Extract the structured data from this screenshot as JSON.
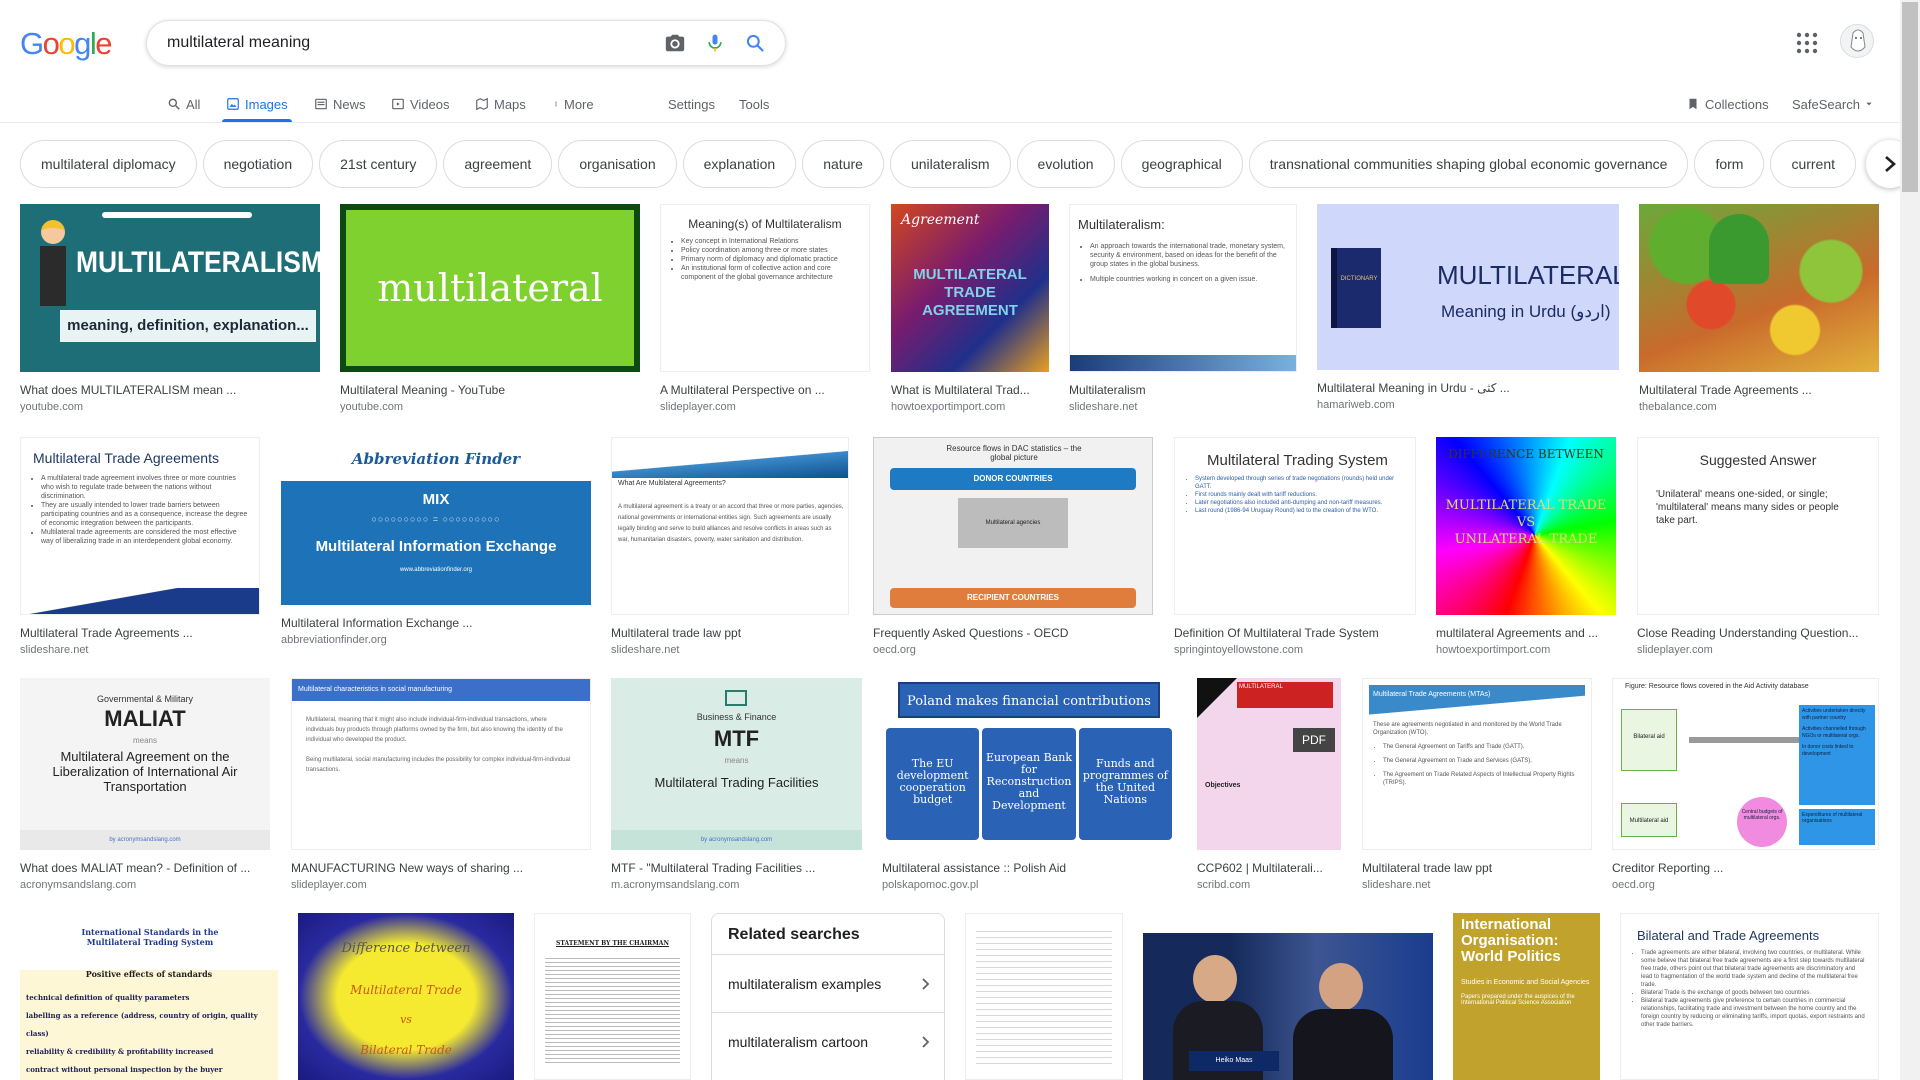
{
  "search": {
    "query": "multilateral meaning"
  },
  "logo": {
    "letters": [
      "G",
      "o",
      "o",
      "g",
      "l",
      "e"
    ],
    "colors": [
      "#4285f4",
      "#ea4335",
      "#fbbc05",
      "#4285f4",
      "#34a853",
      "#ea4335"
    ]
  },
  "tabs": [
    {
      "label": "All",
      "icon": "search-icon"
    },
    {
      "label": "Images",
      "icon": "image-icon"
    },
    {
      "label": "News",
      "icon": "news-icon"
    },
    {
      "label": "Videos",
      "icon": "video-icon"
    },
    {
      "label": "Maps",
      "icon": "map-icon"
    },
    {
      "label": "More",
      "icon": "more-icon"
    }
  ],
  "tools": {
    "settings": "Settings",
    "tools": "Tools",
    "collections": "Collections",
    "safesearch": "SafeSearch"
  },
  "chips": [
    "multilateral diplomacy",
    "negotiation",
    "21st century",
    "agreement",
    "organisation",
    "explanation",
    "nature",
    "unilateralism",
    "evolution",
    "geographical",
    "transnational communities shaping global economic governance",
    "form",
    "current"
  ],
  "results": [
    {
      "caption": "What does MULTILATERALISM mean ...",
      "source": "youtube.com",
      "text": [
        "MULTILATERALISM",
        "meaning, definition, explanation..."
      ]
    },
    {
      "caption": "Multilateral Meaning - YouTube",
      "source": "youtube.com",
      "text": [
        "multilateral"
      ]
    },
    {
      "caption": "A Multilateral Perspective on ...",
      "source": "slideplayer.com",
      "text": [
        "Meaning(s) of Multilateralism",
        "Key concept in International Relations",
        "Policy coordination among three or more states",
        "Primary norm of diplomacy and diplomatic practice",
        "An institutional form of collective action and core component of the global governance architecture"
      ]
    },
    {
      "caption": "What is Multilateral Trad...",
      "source": "howtoexportimport.com",
      "text": [
        "Agreement",
        "MULTILATERAL TRADE AGREEMENT"
      ]
    },
    {
      "caption": "Multilateralism",
      "source": "slideshare.net",
      "text": [
        "Multilateralism:",
        "An approach towards the international trade, monetary system, security & environment, based on ideas for the benefit of the group states in the global business.",
        "Multiple countries working in concert on a given issue."
      ]
    },
    {
      "caption": "Multilateral Meaning in Urdu - کثی ...",
      "source": "hamariweb.com",
      "text": [
        "MULTILATERAL",
        "Meaning in Urdu (اردو)",
        "DICTIONARY"
      ]
    },
    {
      "caption": "Multilateral Trade Agreements ...",
      "source": "thebalance.com",
      "text": []
    },
    {
      "caption": "Multilateral Trade Agreements ...",
      "source": "slideshare.net",
      "text": [
        "Multilateral Trade Agreements",
        "A multilateral trade agreement involves three or more countries who wish to regulate trade between the nations without discrimination.",
        "They are usually intended to lower trade barriers between participating countries and as a consequence, increase the degree of economic integration between the participants.",
        "Multilateral trade agreements are considered the most effective way of liberalizing trade in an interdependent global economy."
      ]
    },
    {
      "caption": "Multilateral Information Exchange ...",
      "source": "abbreviationfinder.org",
      "text": [
        "Abbreviation Finder",
        "MIX",
        "Multilateral Information Exchange",
        "www.abbreviationfinder.org"
      ]
    },
    {
      "caption": "Multilateral trade law ppt",
      "source": "slideshare.net",
      "text": [
        "What Are Multilateral Agreements?",
        "A multilateral agreement is a treaty or an accord that three or more parties, agencies, national governments or international entities sign. Such agreements are usually legally binding and serve to build alliances and resolve conflicts in areas such as war, humanitarian disasters, poverty, water sanitation and distribution."
      ]
    },
    {
      "caption": "Frequently Asked Questions - OECD",
      "source": "oecd.org",
      "text": [
        "Resource flows in DAC statistics – the global picture",
        "DONOR COUNTRIES",
        "Multilateral agencies",
        "RECIPIENT COUNTRIES"
      ]
    },
    {
      "caption": "Definition Of Multilateral Trade System",
      "source": "springintoyellowstone.com",
      "text": [
        "Multilateral Trading System",
        "System developed through series of trade negotiations (rounds) held under GATT.",
        "First rounds mainly dealt with tariff reductions.",
        "Later negotiations also included anti-dumping and non-tariff measures.",
        "Last round (1986-94 Uruguay Round) led to the creation of the WTO."
      ]
    },
    {
      "caption": "multilateral Agreements and ...",
      "source": "howtoexportimport.com",
      "text": [
        "DIFFERENCE BETWEEN",
        "MULTILATERAL TRADE",
        "VS",
        "UNILATERAL TRADE"
      ]
    },
    {
      "caption": "Close Reading Understanding Question...",
      "source": "slideplayer.com",
      "text": [
        "Suggested Answer",
        "'Unilateral' means one-sided, or single; 'multilateral' means many sides or people take part."
      ]
    },
    {
      "caption": "What does MALIAT mean? - Definition of ...",
      "source": "acronymsandslang.com",
      "text": [
        "Governmental & Military",
        "MALIAT",
        "means",
        "Multilateral Agreement on the Liberalization of International Air Transportation",
        "by acronymsandslang.com"
      ]
    },
    {
      "caption": "MANUFACTURING New ways of sharing ...",
      "source": "slideplayer.com",
      "text": [
        "Multilateral characteristics in social manufacturing",
        "Multilateral, meaning that it might also include individual-firm-individual transactions, where individuals buy products through platforms owned by the firm, but also knowing the identity of the individual who developed the product.",
        "Being multilateral, social manufacturing includes the possibility for complex individual-firm-individual transactions."
      ]
    },
    {
      "caption": "MTF - \"Multilateral Trading Facilities ...",
      "source": "m.acronymsandslang.com",
      "text": [
        "Business & Finance",
        "MTF",
        "means",
        "Multilateral Trading Facilities",
        "by acronymsandslang.com"
      ]
    },
    {
      "caption": "Multilateral assistance :: Polish Aid",
      "source": "polskapomoc.gov.pl",
      "text": [
        "Poland makes financial contributions to:",
        "The EU development cooperation budget",
        "European Bank for Reconstruction and Development",
        "Funds and programmes of the United Nations"
      ]
    },
    {
      "caption": "CCP602 | Multilaterali...",
      "source": "scribd.com",
      "text": [
        "PDF",
        "Objectives"
      ]
    },
    {
      "caption": "Multilateral trade law ppt",
      "source": "slideshare.net",
      "text": [
        "Multilateral Trade Agreements (MTAs)",
        "These are agreements negotiated in and monitored by the World Trade Organization (WTO).",
        "The General Agreement on Tariffs and Trade (GATT).",
        "The General Agreement on Trade and Services (GATS).",
        "The Agreement on Trade Related Aspects of Intellectual Property Rights (TRIPS)."
      ]
    },
    {
      "caption": "Creditor Reporting ...",
      "source": "oecd.org",
      "text": [
        "Figure: Resource flows covered in the Aid Activity database",
        "Bilateral aid",
        "Multilateral aid",
        "Central budgets of multilateral orgs.",
        "Activities undertaken directly with partner country",
        "Activities channelled through NGOs or multilateral orgs.",
        "In donor costs linked to development",
        "Expenditures of multilateral organisations"
      ]
    },
    {
      "caption": "",
      "source": "",
      "text": [
        "International Standards in the Multilateral Trading System",
        "Positive effects of standards",
        "technical definition of quality parameters",
        "labelling as a reference (address, country of origin, quality class)",
        "reliability & credibility & profitability increased",
        "contract without personal inspection by the buyer"
      ]
    },
    {
      "caption": "",
      "source": "",
      "text": [
        "Difference between",
        "Multilateral Trade",
        "vs",
        "Bilateral Trade"
      ]
    },
    {
      "caption": "",
      "source": "",
      "text": [
        "STATEMENT BY THE CHAIRMAN"
      ]
    },
    {
      "caption": "",
      "source": "",
      "text": []
    },
    {
      "caption": "",
      "source": "",
      "text": [
        "Heiko Maas"
      ]
    },
    {
      "caption": "",
      "source": "",
      "text": [
        "International Organisation: World Politics",
        "Studies in Economic and Social Agencies",
        "Papers prepared under the auspices of the International Political Science Association"
      ]
    },
    {
      "caption": "",
      "source": "",
      "text": [
        "Bilateral and Trade Agreements",
        "Trade agreements are either bilateral, involving two countries, or multilateral. While some believe that bilateral free trade agreements are a first step towards multilateral free trade, others point out that bilateral trade agreements are discriminatory and lead to fragmentation of the world trade system and decline of the multilateral free trade.",
        "Bilateral Trade is the exchange of goods between two countries.",
        "Bilateral trade agreements give preference to certain countries in commercial relationships, facilitating trade and investment between the home country and the foreign country by reducing or eliminating tariffs, import quotas, export restraints and other trade barriers."
      ]
    }
  ],
  "related": {
    "title": "Related searches",
    "items": [
      "multilateralism examples",
      "multilateralism cartoon"
    ]
  }
}
